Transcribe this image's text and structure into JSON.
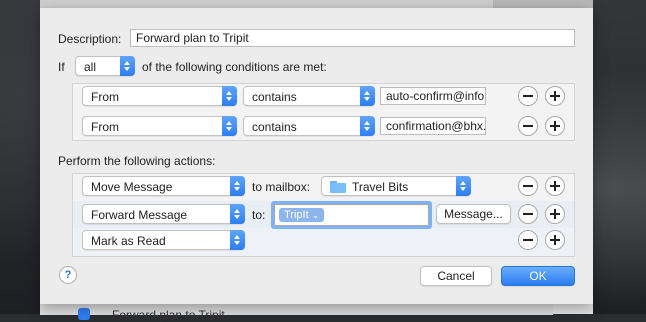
{
  "background_window": {
    "row_label": "Forward plan to Tripit"
  },
  "description": {
    "label": "Description:",
    "value": "Forward plan to Tripit"
  },
  "condition_header": {
    "prefix": "If",
    "quantifier": "all",
    "suffix": "of the following conditions are met:"
  },
  "conditions": [
    {
      "field": "From",
      "operator": "contains",
      "value": "auto-confirm@info"
    },
    {
      "field": "From",
      "operator": "contains",
      "value": "confirmation@bhx."
    }
  ],
  "actions_header": "Perform the following actions:",
  "actions": {
    "move": {
      "action": "Move Message",
      "connector": "to mailbox:",
      "mailbox": "Travel Bits"
    },
    "forward": {
      "action": "Forward Message",
      "connector": "to:",
      "recipient": "TripIt",
      "message_button": "Message..."
    },
    "mark": {
      "action": "Mark as Read"
    }
  },
  "footer": {
    "help": "?",
    "cancel": "Cancel",
    "ok": "OK"
  },
  "colors": {
    "accent": "#2d7ef2",
    "token": "#8cb5ee",
    "focus_ring": "#7fb2f4"
  },
  "icons": {
    "folder": "folder-icon",
    "popup_arrows": "up-down-chevron-icon",
    "remove": "minus-icon",
    "add": "plus-icon",
    "help": "help-icon"
  }
}
